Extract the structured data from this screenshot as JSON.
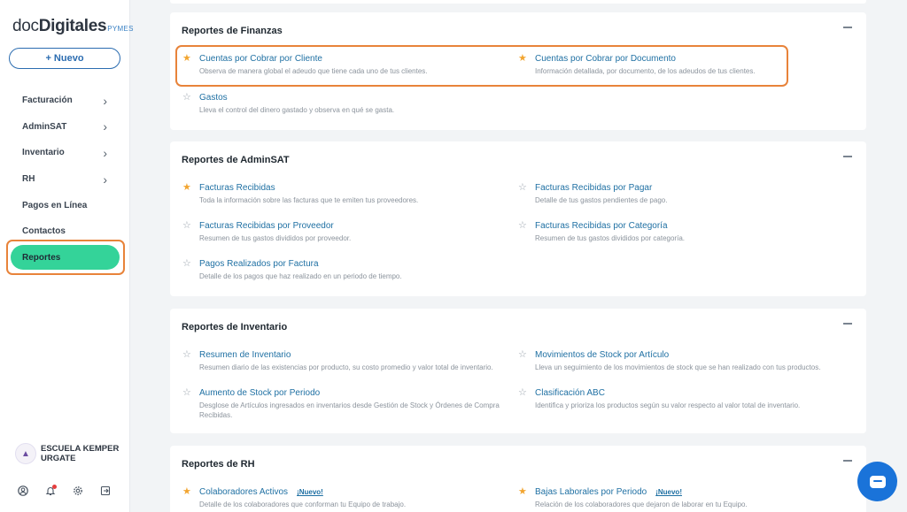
{
  "brand": {
    "part1": "doc",
    "part2": "Digitales",
    "suffix": "PYMES"
  },
  "new_button": {
    "label": "+ Nuevo"
  },
  "nav": {
    "items": [
      {
        "label": "Facturación",
        "chevron": "›"
      },
      {
        "label": "AdminSAT",
        "chevron": "›"
      },
      {
        "label": "Inventario",
        "chevron": "›"
      },
      {
        "label": "RH",
        "chevron": "›"
      },
      {
        "label": "Pagos en Línea",
        "chevron": ""
      },
      {
        "label": "Contactos",
        "chevron": ""
      }
    ],
    "active": {
      "label": "Reportes"
    }
  },
  "org": {
    "name": "ESCUELA KEMPER URGATE"
  },
  "bottom_icons": [
    "user-icon",
    "bell-icon",
    "gear-icon",
    "logout-icon"
  ],
  "colors": {
    "accent": "#34d399",
    "link": "#1f70a3",
    "star_on": "#f2a530",
    "highlight": "#e8833a",
    "chat": "#1a73d9"
  },
  "sections": [
    {
      "title": "Reportes de Finanzas",
      "reports": [
        {
          "title": "Cuentas por Cobrar por Cliente",
          "desc": "Observa de manera global el adeudo que tiene cada uno de tus clientes.",
          "starred": true,
          "badge": ""
        },
        {
          "title": "Cuentas por Cobrar por Documento",
          "desc": "Información detallada, por documento, de los adeudos de tus clientes.",
          "starred": true,
          "badge": ""
        },
        {
          "title": "Gastos",
          "desc": "Lleva el control del dinero gastado y observa en qué se gasta.",
          "starred": false,
          "badge": ""
        }
      ]
    },
    {
      "title": "Reportes de AdminSAT",
      "reports": [
        {
          "title": "Facturas Recibidas",
          "desc": "Toda la información sobre las facturas que te emiten tus proveedores.",
          "starred": true,
          "badge": ""
        },
        {
          "title": "Facturas Recibidas por Pagar",
          "desc": "Detalle de tus gastos pendientes de pago.",
          "starred": false,
          "badge": ""
        },
        {
          "title": "Facturas Recibidas por Proveedor",
          "desc": "Resumen de tus gastos divididos por proveedor.",
          "starred": false,
          "badge": ""
        },
        {
          "title": "Facturas Recibidas por Categoría",
          "desc": "Resumen de tus gastos divididos por categoría.",
          "starred": false,
          "badge": ""
        },
        {
          "title": "Pagos Realizados por Factura",
          "desc": "Detalle de los pagos que haz realizado en un periodo de tiempo.",
          "starred": false,
          "badge": ""
        }
      ]
    },
    {
      "title": "Reportes de Inventario",
      "reports": [
        {
          "title": "Resumen de Inventario",
          "desc": "Resumen diario de las existencias por producto, su costo promedio y valor total de inventario.",
          "starred": false,
          "badge": ""
        },
        {
          "title": "Movimientos de Stock por Artículo",
          "desc": "Lleva un seguimiento de los movimientos de stock que se han realizado con tus productos.",
          "starred": false,
          "badge": ""
        },
        {
          "title": "Aumento de Stock por Periodo",
          "desc": "Desglose de Artículos ingresados en inventarios desde Gestión de Stock y Órdenes de Compra Recibidas.",
          "starred": false,
          "badge": ""
        },
        {
          "title": "Clasificación ABC",
          "desc": "Identifica y prioriza los productos según su valor respecto al valor total de inventario.",
          "starred": false,
          "badge": ""
        }
      ]
    },
    {
      "title": "Reportes de RH",
      "reports": [
        {
          "title": "Colaboradores Activos",
          "desc": "Detalle de los colaboradores que conforman tu Equipo de trabajo.",
          "starred": true,
          "badge": "¡Nuevo!"
        },
        {
          "title": "Bajas Laborales por Periodo",
          "desc": "Relación de los colaboradores que dejaron de laborar en tu Equipo.",
          "starred": true,
          "badge": "¡Nuevo!"
        }
      ]
    }
  ]
}
